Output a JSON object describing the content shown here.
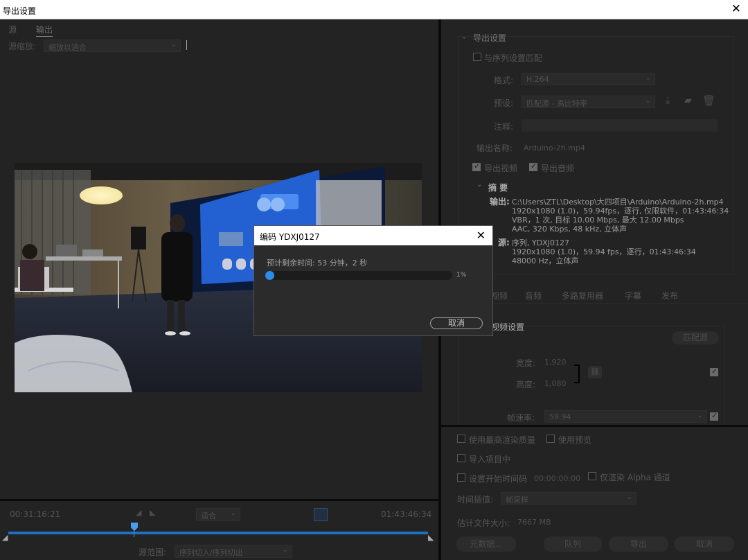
{
  "window": {
    "title": "导出设置",
    "close_glyph": "✕"
  },
  "left": {
    "tabs": [
      {
        "label": "源"
      },
      {
        "label": "输出"
      }
    ],
    "scale_label": "源缩放:",
    "scale_value": "缩放以适合",
    "timecode_current": "00:31:16:21",
    "timecode_total": "01:43:46:34",
    "fit_value": "适合",
    "source_range_label": "源范围:",
    "source_range_value": "序列切入/序列切出"
  },
  "export_settings": {
    "heading": "导出设置",
    "match_sequence": "与序列设置匹配",
    "format_label": "格式:",
    "format_value": "H.264",
    "preset_label": "预设:",
    "preset_value": "匹配源 - 高比特率",
    "comment_label": "注释:",
    "output_name_label": "输出名称:",
    "output_name_value": "Arduino-2h.mp4",
    "export_video": "导出视频",
    "export_audio": "导出音频",
    "summary_label": "摘 要",
    "output_key": "输出:",
    "output_lines": [
      "C:\\Users\\ZTL\\Desktop\\大四项目\\Arduino\\Arduino-2h.mp4",
      "1920x1080 (1.0)，59.94fps，逐行, 仅限软件，01:43:46:34",
      "VBR，1 次, 目标 10.00 Mbps, 最大 12.00 Mbps",
      "AAC, 320 Kbps, 48  kHz, 立体声"
    ],
    "source_key": "源:",
    "source_lines": [
      "序列, YDXJ0127",
      "1920x1080 (1.0)，59.94 fps，逐行，01:43:46:34",
      "48000 Hz，立体声"
    ]
  },
  "settings_tabs": [
    {
      "label": "视频"
    },
    {
      "label": "音频"
    },
    {
      "label": "多路复用器"
    },
    {
      "label": "字幕"
    },
    {
      "label": "发布"
    }
  ],
  "video_settings": {
    "heading": "视频设置",
    "match_source_button": "匹配源",
    "width_label": "宽度:",
    "width_value": "1,920",
    "height_label": "高度:",
    "height_value": "1,080",
    "frame_rate_label": "帧速率:",
    "frame_rate_value": "59.94"
  },
  "render_options": {
    "max_render_quality": "使用最高渲染质量",
    "use_preview": "使用预览",
    "import_into_project": "导入项目中",
    "set_start_timecode": "设置开始时间码",
    "start_timecode_value": "00:00:00:00",
    "render_alpha_only": "仅渲染 Alpha 通道",
    "time_interpolation_label": "时间插值:",
    "time_interpolation_value": "帧采样",
    "file_size_label": "估计文件大小:",
    "file_size_value": "7667 MB"
  },
  "footer_buttons": {
    "metadata": "元数据...",
    "queue": "队列",
    "export": "导出",
    "cancel": "取消"
  },
  "encode_dialog": {
    "title": "编码 YDXJ0127",
    "remaining": "预计剩余时间: 53 分钟，2 秒",
    "progress": 0.01,
    "progress_label": "1%",
    "cancel": "取消"
  },
  "colors": {
    "accent": "#2d8ceb",
    "panel": "#232323",
    "divider": "#0a0a0a"
  }
}
